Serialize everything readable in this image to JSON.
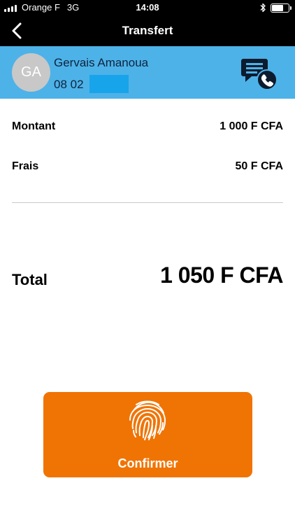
{
  "status_bar": {
    "carrier": "Orange F",
    "network": "3G",
    "time": "14:08",
    "battery_level": 0.7,
    "icons": [
      "signal-icon",
      "bluetooth-icon",
      "battery-icon"
    ]
  },
  "nav": {
    "title": "Transfert",
    "back_icon": "chevron-left-icon"
  },
  "contact": {
    "initials": "GA",
    "name": "Gervais Amanoua",
    "phone_prefix": "08 02",
    "icon": "chat-call-icon"
  },
  "details": {
    "montant_label": "Montant",
    "montant_value": "1 000 F CFA",
    "frais_label": "Frais",
    "frais_value": "50 F CFA",
    "total_label": "Total",
    "total_value": "1 050 F CFA"
  },
  "confirm": {
    "label": "Confirmer",
    "icon": "fingerprint-icon"
  },
  "colors": {
    "contact_bar": "#4db2e8",
    "accent_orange": "#f07404",
    "header_black": "#000000"
  }
}
